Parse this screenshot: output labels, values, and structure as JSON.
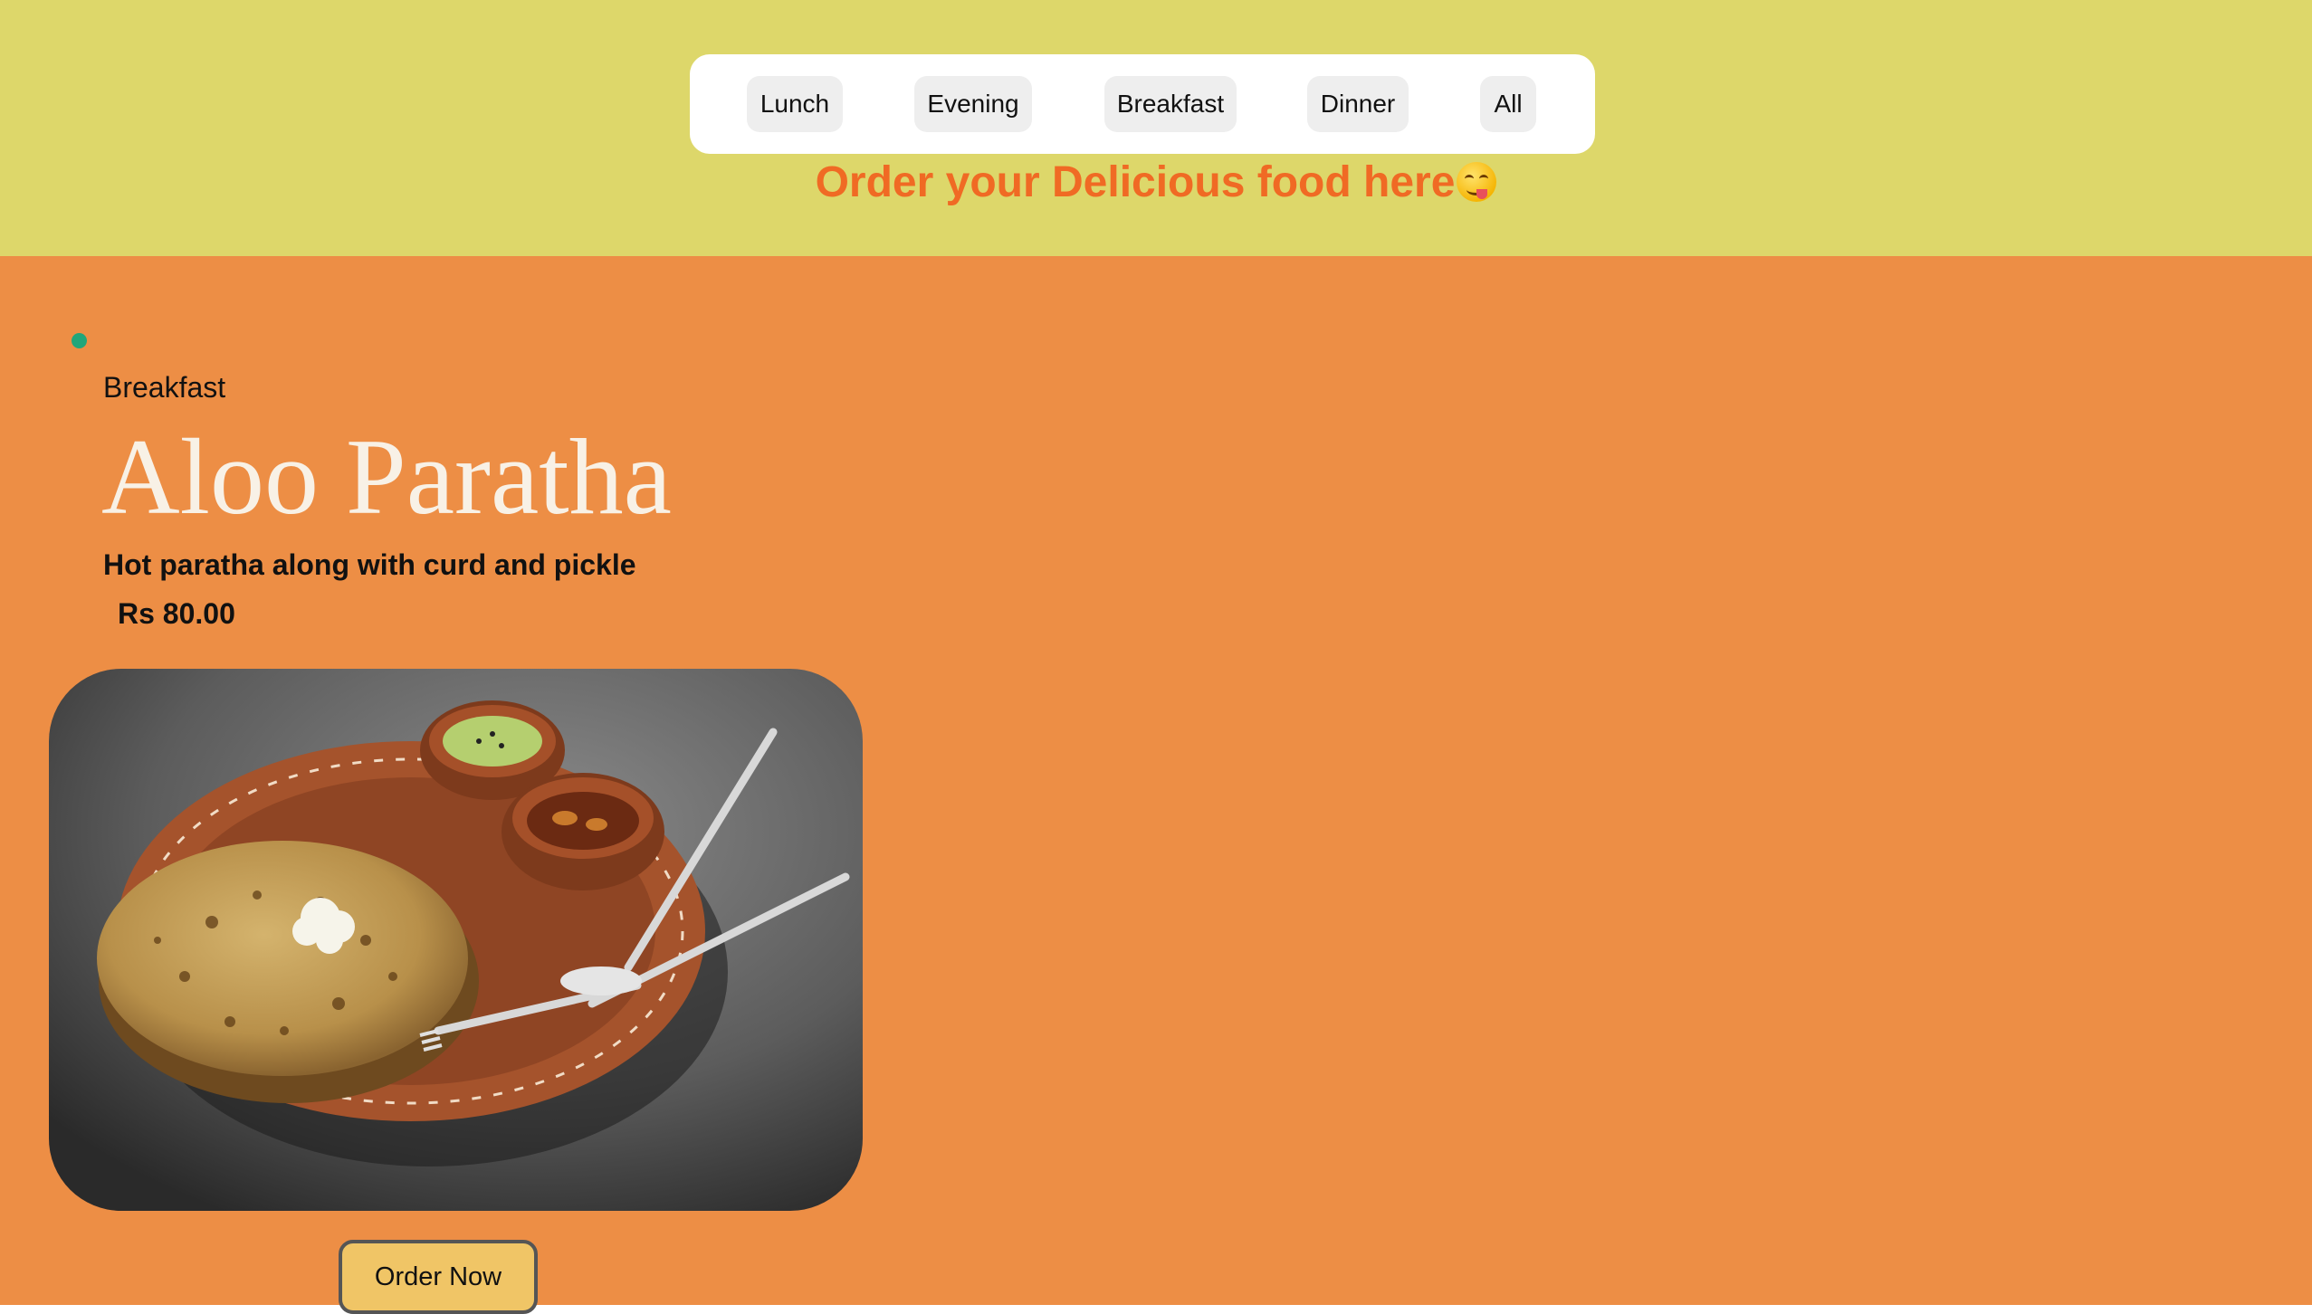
{
  "filters": [
    {
      "label": "Lunch"
    },
    {
      "label": "Evening"
    },
    {
      "label": "Breakfast"
    },
    {
      "label": "Dinner"
    },
    {
      "label": "All"
    }
  ],
  "headline": {
    "text": "Order your Delicious food here",
    "emoji_icon": "face-savoring-food-emoji"
  },
  "item": {
    "category": "Breakfast",
    "title": "Aloo Paratha",
    "description": "Hot paratha along with curd and pickle",
    "price": "Rs 80.00",
    "image_icon": "aloo-paratha-plate-photo",
    "order_label": "Order Now"
  },
  "colors": {
    "header_bg": "#ddd76a",
    "main_bg": "#ed8e45",
    "headline": "#f06a24",
    "title": "#f8f1e6",
    "button_bg": "#f0c566",
    "bullet": "#21a67a"
  }
}
